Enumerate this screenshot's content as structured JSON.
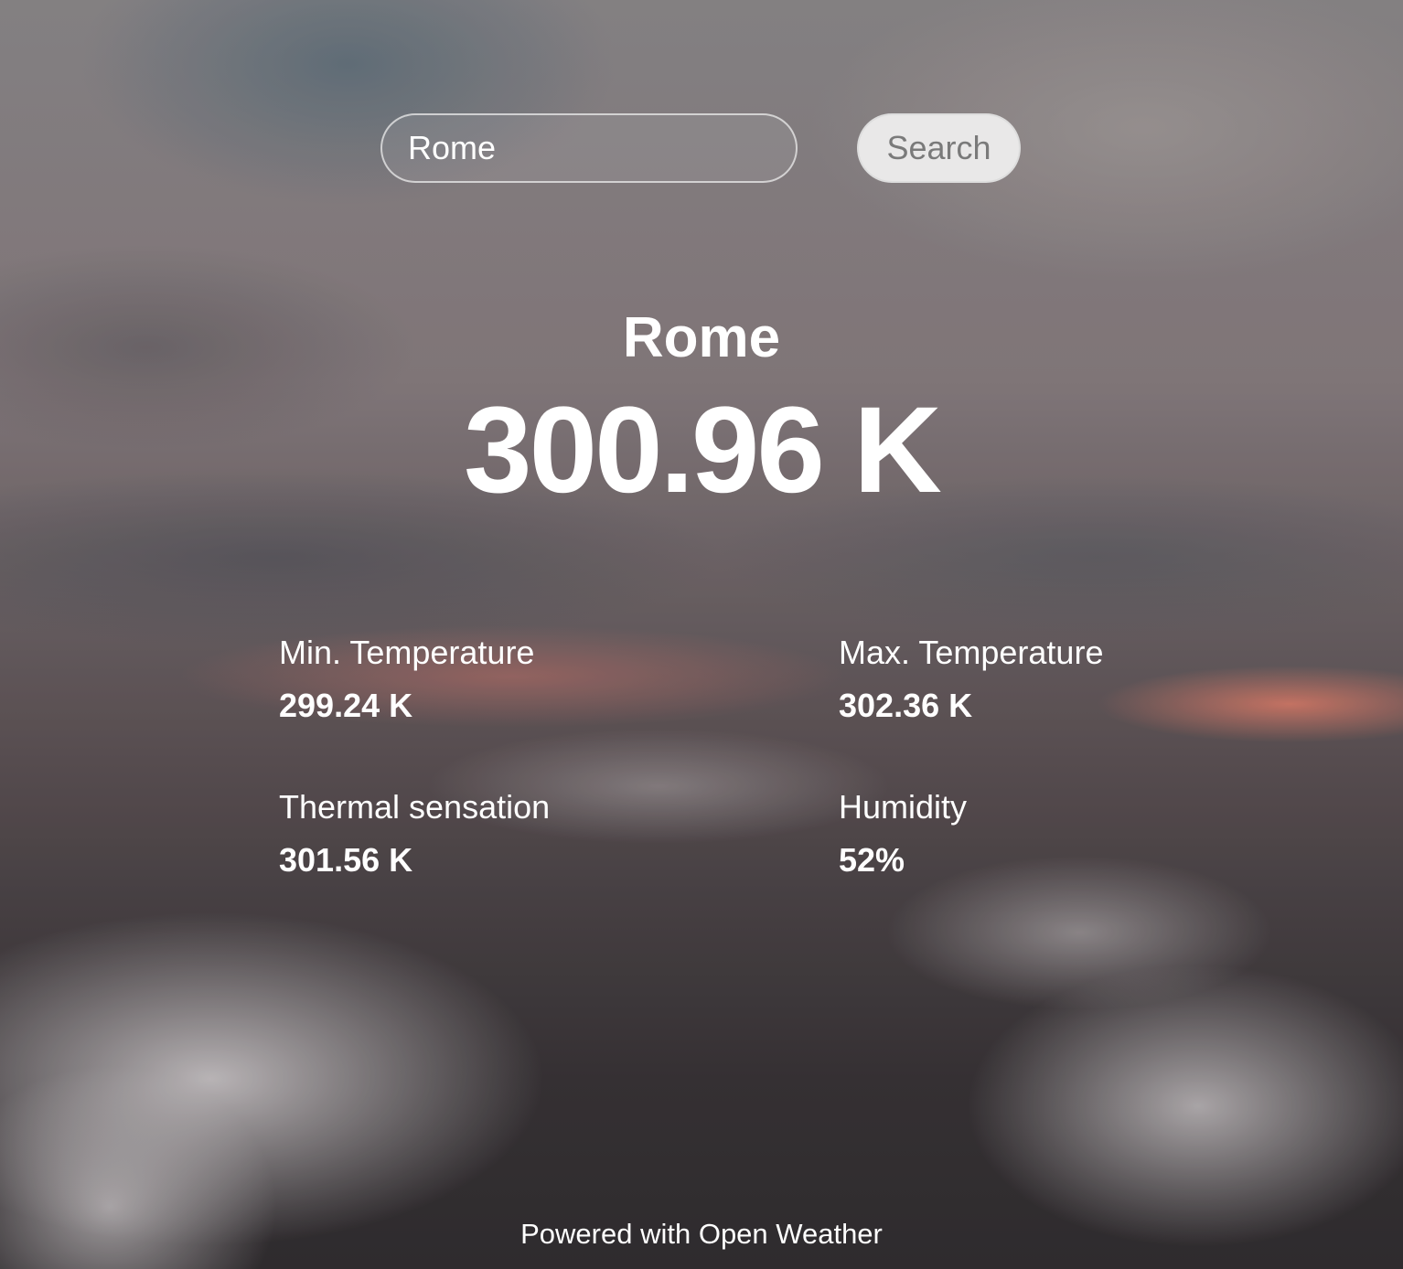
{
  "search": {
    "value": "Rome",
    "button_label": "Search"
  },
  "weather": {
    "city": "Rome",
    "temperature": "300.96 K"
  },
  "stats": {
    "min_temp": {
      "label": "Min. Temperature",
      "value": "299.24 K"
    },
    "max_temp": {
      "label": "Max. Temperature",
      "value": "302.36 K"
    },
    "feels_like": {
      "label": "Thermal sensation",
      "value": "301.56 K"
    },
    "humidity": {
      "label": "Humidity",
      "value": "52%"
    }
  },
  "footer": {
    "text": "Powered with Open Weather"
  },
  "colors": {
    "text": "#ffffff",
    "button_background": "#e9e8e8",
    "button_text": "#7a7a7a"
  }
}
